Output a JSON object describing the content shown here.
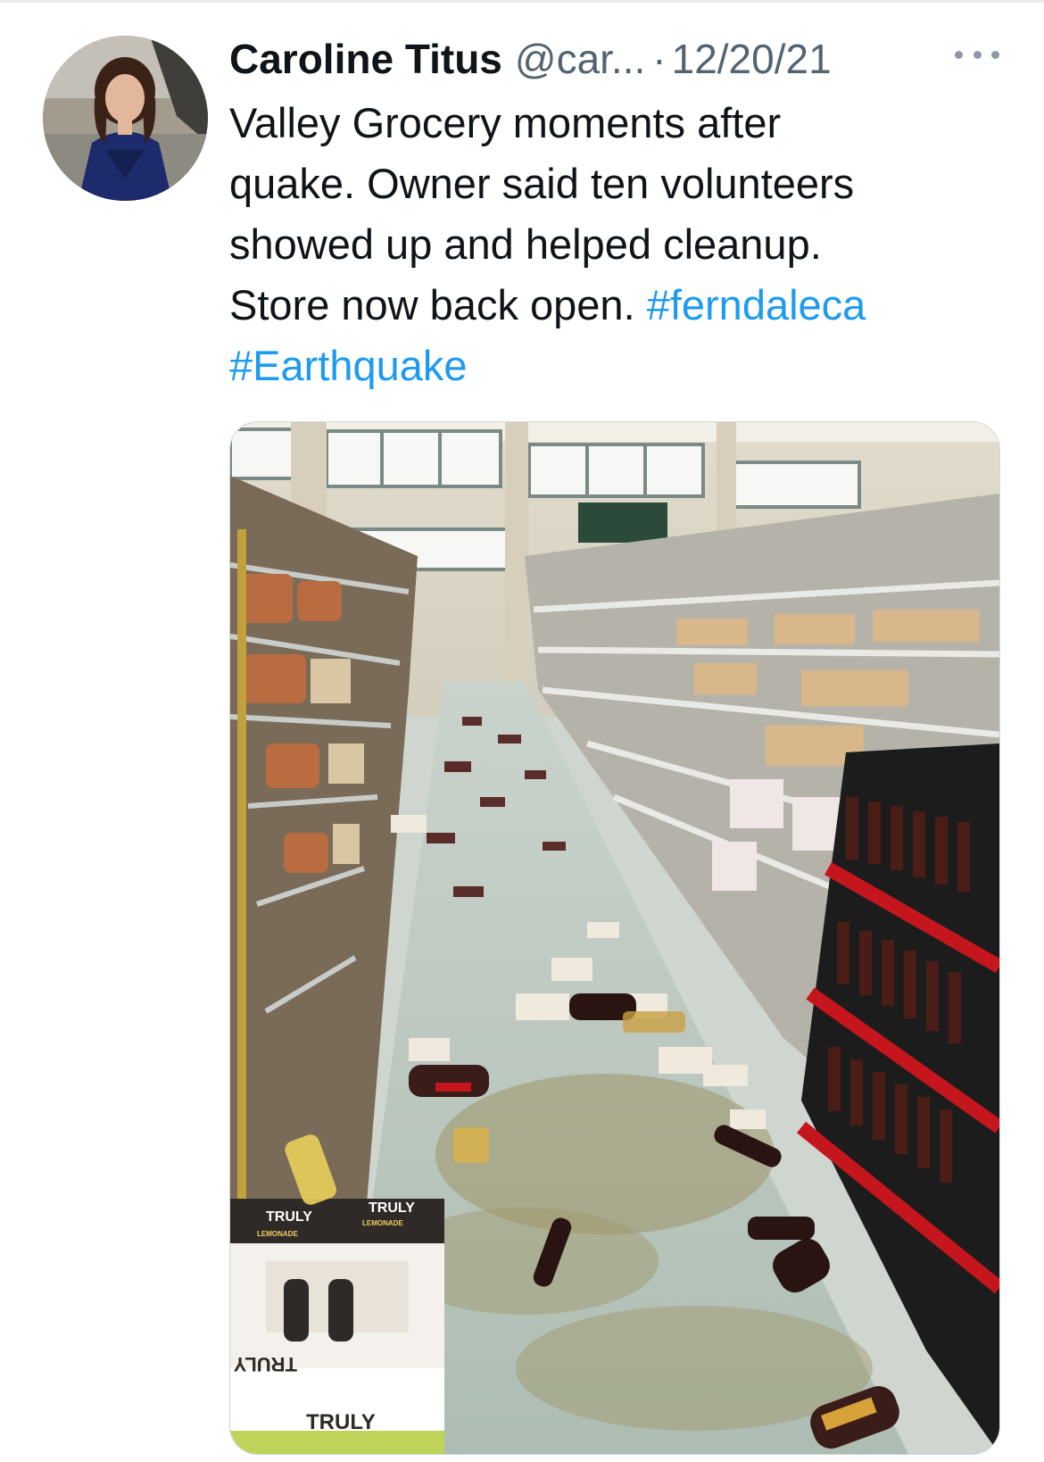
{
  "tweet": {
    "author_name": "Caroline Titus",
    "handle": "@car...",
    "separator": "·",
    "date": "12/20/21",
    "text_lines": [
      "Valley Grocery moments after",
      "quake. Owner said ten volunteers",
      "showed up and helped cleanup.",
      "Store now back open."
    ],
    "hashtags": [
      "#ferndaleca",
      "#Earthquake"
    ]
  },
  "media": {
    "sign_text": [
      "TRULY",
      "LEMONADE",
      "TRULY",
      "LEMONADE",
      "TRULY",
      "TRULY"
    ]
  },
  "icons": {
    "more": "more-horizontal-icon"
  },
  "colors": {
    "link": "#1d9bf0",
    "secondary_text": "#536471",
    "primary_text": "#0f1419"
  }
}
